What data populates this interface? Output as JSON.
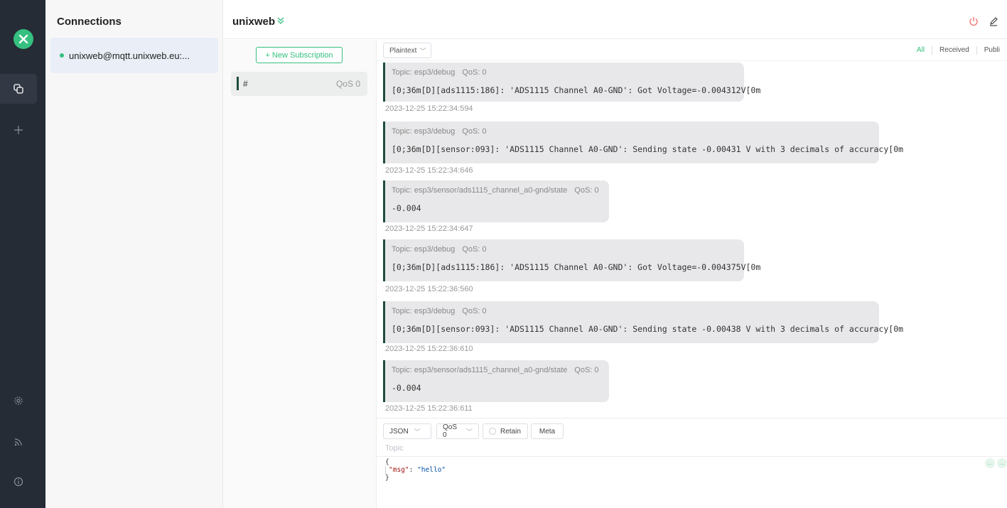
{
  "nav": {
    "items": [
      "connections-icon",
      "add-icon",
      "settings-icon",
      "feed-icon",
      "info-icon"
    ]
  },
  "connections": {
    "title": "Connections",
    "items": [
      {
        "label": "unixweb@mqtt.unixweb.eu:...",
        "status": "connected"
      }
    ]
  },
  "header": {
    "title": "unixweb"
  },
  "subscriptions": {
    "new_button": "+ New Subscription",
    "items": [
      {
        "topic": "#",
        "qos": "QoS 0"
      }
    ]
  },
  "messages": {
    "format": "Plaintext",
    "filters": [
      "All",
      "Received",
      "Publi"
    ],
    "items": [
      {
        "topic": "Topic: esp3/debug",
        "qos": "QoS: 0",
        "payload": "[0;36m[D][ads1115:186]: 'ADS1115 Channel A0-GND': Got Voltage=-0.004312V[0m",
        "time": "2023-12-25 15:22:34:594"
      },
      {
        "topic": "Topic: esp3/debug",
        "qos": "QoS: 0",
        "payload": "[0;36m[D][sensor:093]: 'ADS1115 Channel A0-GND': Sending state -0.00431 V with 3 decimals of accuracy[0m",
        "time": "2023-12-25 15:22:34:646"
      },
      {
        "topic": "Topic: esp3/sensor/ads1115_channel_a0-gnd/state",
        "qos": "QoS: 0",
        "payload": "-0.004",
        "time": "2023-12-25 15:22:34:647"
      },
      {
        "topic": "Topic: esp3/debug",
        "qos": "QoS: 0",
        "payload": "[0;36m[D][ads1115:186]: 'ADS1115 Channel A0-GND': Got Voltage=-0.004375V[0m",
        "time": "2023-12-25 15:22:36:560"
      },
      {
        "topic": "Topic: esp3/debug",
        "qos": "QoS: 0",
        "payload": "[0;36m[D][sensor:093]: 'ADS1115 Channel A0-GND': Sending state -0.00438 V with 3 decimals of accuracy[0m",
        "time": "2023-12-25 15:22:36:610"
      },
      {
        "topic": "Topic: esp3/sensor/ads1115_channel_a0-gnd/state",
        "qos": "QoS: 0",
        "payload": "-0.004",
        "time": "2023-12-25 15:22:36:611"
      }
    ]
  },
  "publish": {
    "format": "JSON",
    "qos": "QoS 0",
    "retain_label": "Retain",
    "meta_label": "Meta",
    "topic_placeholder": "Topic",
    "code_open": "{",
    "code_key": "\"msg\"",
    "code_colon": ": ",
    "code_value": "\"hello\"",
    "code_close": "}"
  },
  "colors": {
    "accent": "#35c07f",
    "sidebar": "#262c36",
    "power": "#f56c6c"
  }
}
